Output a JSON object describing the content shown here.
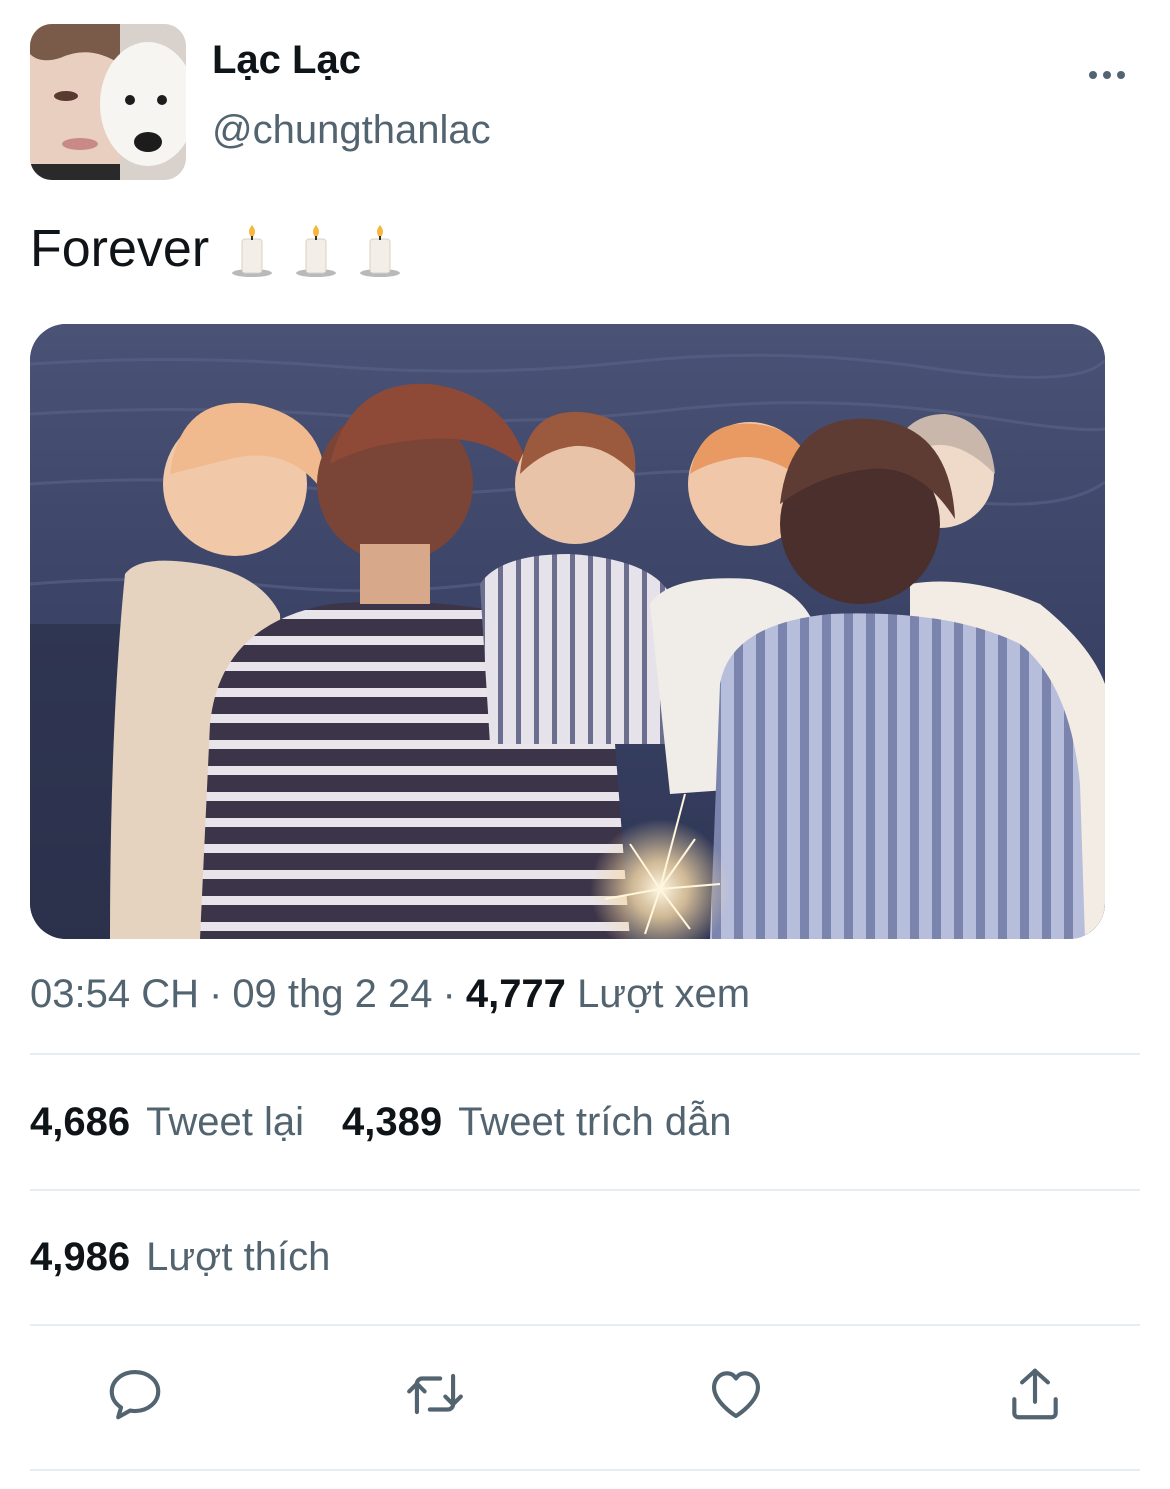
{
  "author": {
    "display_name": "Lạc Lạc",
    "handle": "@chungthanlac"
  },
  "tweet": {
    "text": "Forever",
    "emoji": [
      "candle",
      "candle",
      "candle"
    ]
  },
  "meta": {
    "time": "03:54 CH",
    "separator": "·",
    "date": "09 thg 2 24",
    "views_count": "4,777",
    "views_label": "Lượt xem"
  },
  "stats": {
    "retweets_count": "4,686",
    "retweets_label": "Tweet lại",
    "quotes_count": "4,389",
    "quotes_label": "Tweet trích dẫn",
    "likes_count": "4,986",
    "likes_label": "Lượt thích"
  },
  "actions": [
    {
      "name": "reply",
      "icon": "reply-icon"
    },
    {
      "name": "retweet",
      "icon": "retweet-icon"
    },
    {
      "name": "like",
      "icon": "heart-icon"
    },
    {
      "name": "share",
      "icon": "share-icon"
    }
  ],
  "colors": {
    "text_primary": "#0f1419",
    "text_secondary": "#536471",
    "divider": "#e6ecf0",
    "icon": "#536471"
  }
}
